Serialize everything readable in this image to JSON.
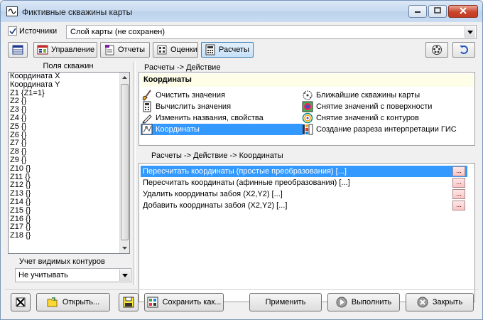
{
  "window": {
    "title": "Фиктивные скважины карты"
  },
  "top": {
    "sources_label": "Источники",
    "sources_checked": true,
    "layer_combo_value": "Слой карты (не сохранен)"
  },
  "toolbar": {
    "manage_label": "Управление",
    "reports_label": "Отчеты",
    "estimates_label": "Оценки",
    "calc_label": "Расчеты"
  },
  "left": {
    "group_title": "Поля скважин",
    "fields": [
      "Координата X",
      "Координата Y",
      "Z1 {Z1=1}",
      "Z2 {}",
      "Z3 {}",
      "Z4 {}",
      "Z5 {}",
      "Z6 {}",
      "Z7 {}",
      "Z8 {}",
      "Z9 {}",
      "Z10 {}",
      "Z11 {}",
      "Z12 {}",
      "Z13 {}",
      "Z14 {}",
      "Z15 {}",
      "Z16 {}",
      "Z17 {}",
      "Z18 {}"
    ],
    "contours_label": "Учет видимых контуров",
    "contours_value": "Не учитывать"
  },
  "actions": {
    "section_title": "Расчеты -> Действие",
    "header": "Координаты",
    "left_items": [
      {
        "label": "Очистить значения",
        "icon": "brush-icon"
      },
      {
        "label": "Вычислить значения",
        "icon": "calculator-icon"
      },
      {
        "label": "Изменить названия, свойства",
        "icon": "pencil-icon"
      },
      {
        "label": "Координаты",
        "icon": "coordinates-icon"
      }
    ],
    "right_items": [
      {
        "label": "Ближайшие скважины карты",
        "icon": "nearest-wells-icon"
      },
      {
        "label": "Снятие значений с поверхности",
        "icon": "surface-icon"
      },
      {
        "label": "Снятие значений с контуров",
        "icon": "contours-icon"
      },
      {
        "label": "Создание разреза интерпретации ГИС",
        "icon": "section-icon"
      }
    ],
    "selected": "Координаты"
  },
  "coords": {
    "section_title": "Расчеты -> Действие -> Координаты",
    "rows": [
      "Пересчитать координаты (простые преобразования) [...]",
      "Пересчитать координаты (афинные преобразования) [...]",
      "Удалить координаты забоя (X2,Y2) [...]",
      "Добавить координаты забоя (X2,Y2) [...]"
    ],
    "ellipsis": "...",
    "selected_index": 0
  },
  "bottom": {
    "open_label": "Открыть...",
    "save_as_label": "Сохранить как...",
    "apply_label": "Применить",
    "run_label": "Выполнить",
    "close_label": "Закрыть"
  },
  "colors": {
    "selection": "#3399ff",
    "header_bg": "#fdfde8",
    "title_bar": "#c7daf0",
    "close_btn": "#c43a22"
  }
}
